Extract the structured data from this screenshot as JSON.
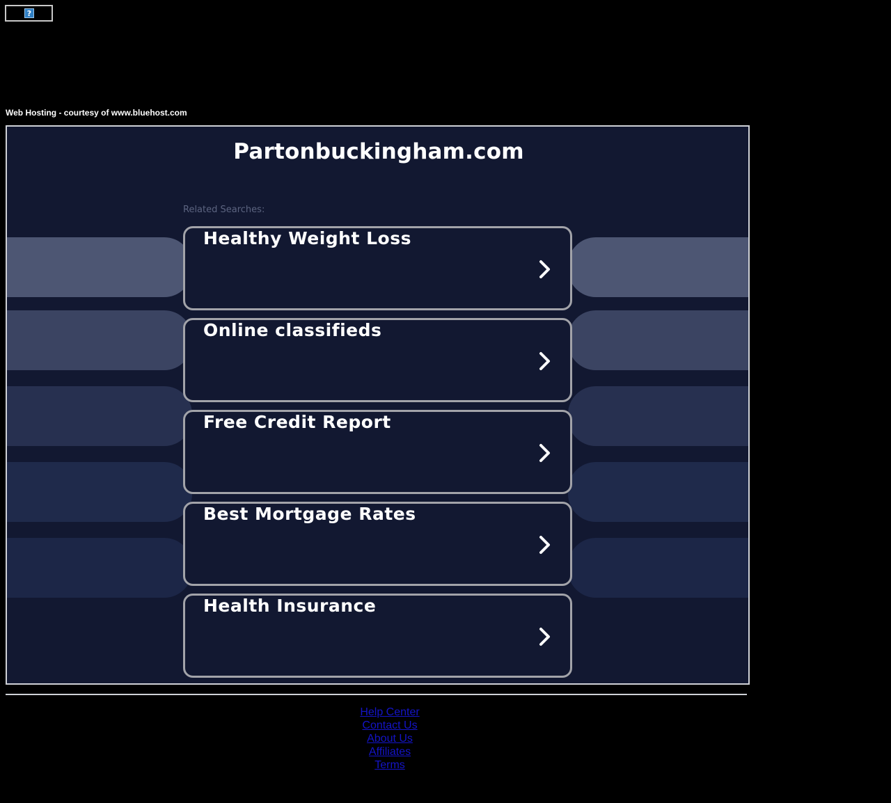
{
  "top_icon": {
    "glyph": "?",
    "name": "broken-image-icon"
  },
  "courtesy_text": "Web Hosting - courtesy of www.bluehost.com",
  "main": {
    "title": "Partonbuckingham.com",
    "related_label": "Related Searches:",
    "searches": [
      {
        "label": "Healthy Weight Loss"
      },
      {
        "label": "Online classifieds"
      },
      {
        "label": "Free Credit Report"
      },
      {
        "label": "Best Mortgage Rates"
      },
      {
        "label": "Health Insurance"
      }
    ],
    "colors": {
      "background": "#121831",
      "pill_colors": [
        "#4d5673",
        "#3b4462",
        "#273050",
        "#1f2a4b",
        "#1c2647"
      ],
      "button_border": "#a2a3a9"
    }
  },
  "footer": {
    "links": [
      {
        "label": "Help Center"
      },
      {
        "label": "Contact Us"
      },
      {
        "label": "About Us"
      },
      {
        "label": "Affiliates"
      },
      {
        "label": "Terms"
      }
    ]
  }
}
